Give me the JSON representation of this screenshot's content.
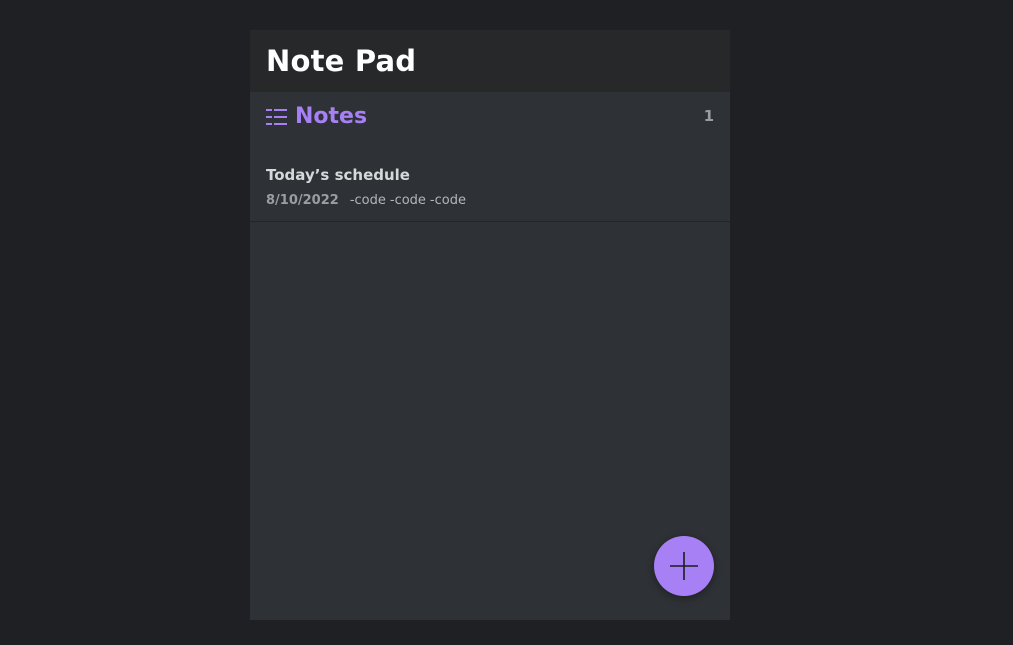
{
  "app": {
    "title": "Note Pad"
  },
  "section": {
    "icon": "list-icon",
    "title": "Notes",
    "count": "1"
  },
  "notes": [
    {
      "title": "Today’s schedule",
      "date": "8/10/2022",
      "tags": [
        "-code",
        "-code",
        "-code"
      ]
    }
  ],
  "fab": {
    "icon": "plus-icon"
  },
  "colors": {
    "accent": "#a780f5",
    "background": "#1f2023",
    "panel": "#2e3135",
    "header": "#27282a"
  }
}
